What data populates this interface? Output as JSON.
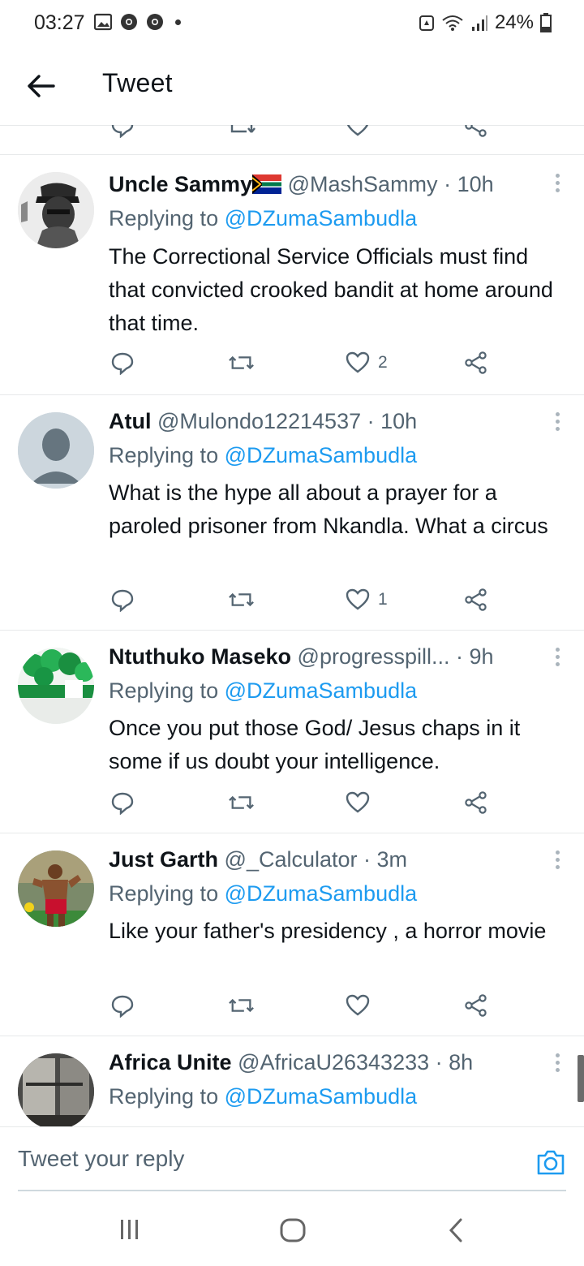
{
  "status_bar": {
    "time": "03:27",
    "battery": "24%"
  },
  "header": {
    "title": "Tweet"
  },
  "reply_prefix": "Replying to",
  "tweets": [
    {
      "name": "Uncle Sammy",
      "handle": "@MashSammy",
      "time": "· 10h",
      "replying_to": "@DZumaSambudla",
      "text": "The Correctional Service Officials must find that convicted crooked bandit at home around that time.",
      "likes": "2",
      "avatar_icon": "profile-photo-man-with-cap"
    },
    {
      "name": "Atul",
      "handle": "@Mulondo12214537",
      "time": "· 10h",
      "replying_to": "@DZumaSambudla",
      "text": "What is the hype all about a prayer for a paroled prisoner from Nkandla. What a circus",
      "likes": "1",
      "avatar_icon": "default-avatar-icon"
    },
    {
      "name": "Ntuthuko Maseko",
      "handle": "@progresspill...",
      "time": "· 9h",
      "replying_to": "@DZumaSambudla",
      "text": "Once you put those God/ Jesus chaps in it some if us doubt your intelligence.",
      "likes": "",
      "avatar_icon": "profile-photo-green-balloons"
    },
    {
      "name": "Just Garth",
      "handle": "@_Calculator",
      "time": "· 3m",
      "replying_to": "@DZumaSambudla",
      "text": "Like your father's presidency , a horror movie",
      "likes": "",
      "avatar_icon": "profile-photo-footballer"
    },
    {
      "name": "Africa Unite",
      "handle": "@AfricaU26343233",
      "time": "· 8h",
      "replying_to": "@DZumaSambudla",
      "text": "",
      "likes": "",
      "avatar_icon": "profile-photo-building"
    }
  ],
  "reply_bar": {
    "placeholder": "Tweet your reply"
  },
  "colors": {
    "link": "#1d9bf0",
    "secondary_text": "#536471",
    "divider": "#e7e9ea"
  }
}
